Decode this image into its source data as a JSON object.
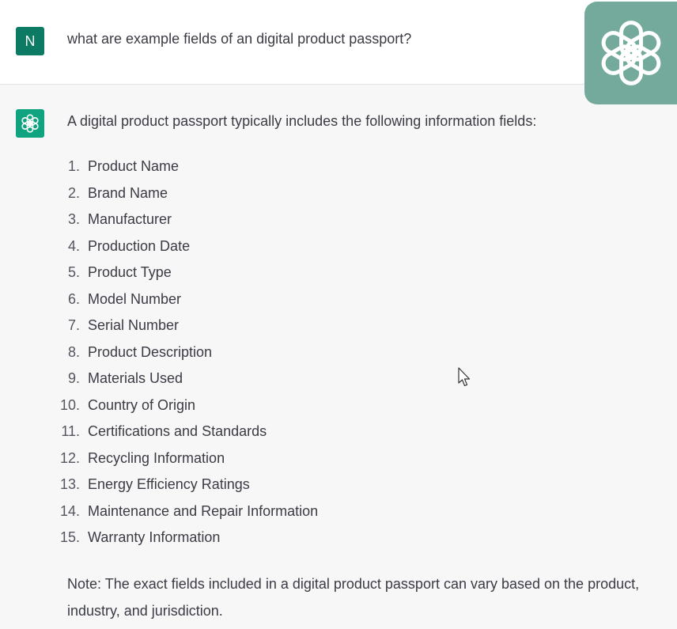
{
  "user": {
    "avatar_letter": "N",
    "message": "what are example fields of an digital product passport?"
  },
  "assistant": {
    "intro": "A digital product passport typically includes the following information fields:",
    "fields": [
      {
        "num": "1.",
        "label": "Product Name"
      },
      {
        "num": "2.",
        "label": "Brand Name"
      },
      {
        "num": "3.",
        "label": "Manufacturer"
      },
      {
        "num": "4.",
        "label": "Production Date"
      },
      {
        "num": "5.",
        "label": "Product Type"
      },
      {
        "num": "6.",
        "label": "Model Number"
      },
      {
        "num": "7.",
        "label": "Serial Number"
      },
      {
        "num": "8.",
        "label": "Product Description"
      },
      {
        "num": "9.",
        "label": "Materials Used"
      },
      {
        "num": "10.",
        "label": "Country of Origin"
      },
      {
        "num": "11.",
        "label": "Certifications and Standards"
      },
      {
        "num": "12.",
        "label": "Recycling Information"
      },
      {
        "num": "13.",
        "label": "Energy Efficiency Ratings"
      },
      {
        "num": "14.",
        "label": "Maintenance and Repair Information"
      },
      {
        "num": "15.",
        "label": "Warranty Information"
      }
    ],
    "note": "Note: The exact fields included in a digital product passport can vary based on the product, industry, and jurisdiction."
  },
  "icons": {
    "brand_logo": "openai-logo-icon",
    "assistant_avatar": "openai-logo-icon",
    "cursor": "mouse-pointer-icon"
  },
  "colors": {
    "user_avatar_bg": "#0d7a63",
    "assistant_avatar_bg": "#10a37f",
    "brand_logo_bg": "#74aa9c",
    "assistant_row_bg": "#f7f7f8",
    "text": "#3b3b44"
  }
}
